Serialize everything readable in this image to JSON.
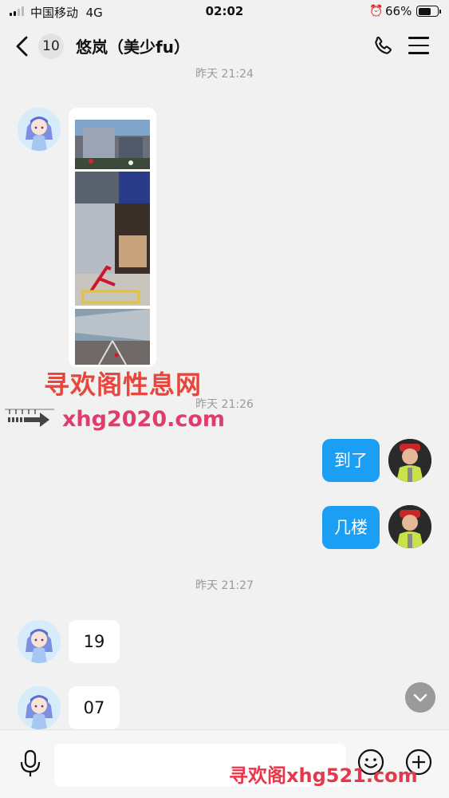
{
  "status_bar": {
    "carrier": "中国移动",
    "network": "4G",
    "time": "02:02",
    "alarm_icon": "alarm-clock-icon",
    "battery": "66%",
    "battery_level": 0.66
  },
  "header": {
    "unread_count": "10",
    "title": "悠岚（美少fu）",
    "icons": [
      "back-arrow-icon",
      "phone-icon",
      "menu-icon"
    ]
  },
  "messages": {
    "timestamp_1": "昨天 21:24",
    "image_alt": "商场位置示意图",
    "timestamp_2": "昨天 21:26",
    "sent_1": "到了",
    "sent_2": "几楼",
    "timestamp_3": "昨天 21:27",
    "received_1": "19",
    "received_2": "07"
  },
  "watermarks": {
    "cn": "寻欢阁性息网",
    "url": "xhg2020.com",
    "bottom": "寻欢阁xhg521.com"
  },
  "input": {
    "placeholder": "",
    "icons": [
      "microphone-icon",
      "emoji-icon",
      "plus-icon"
    ]
  },
  "colors": {
    "accent": "#1a9ff5",
    "background": "#f1f1f1"
  }
}
